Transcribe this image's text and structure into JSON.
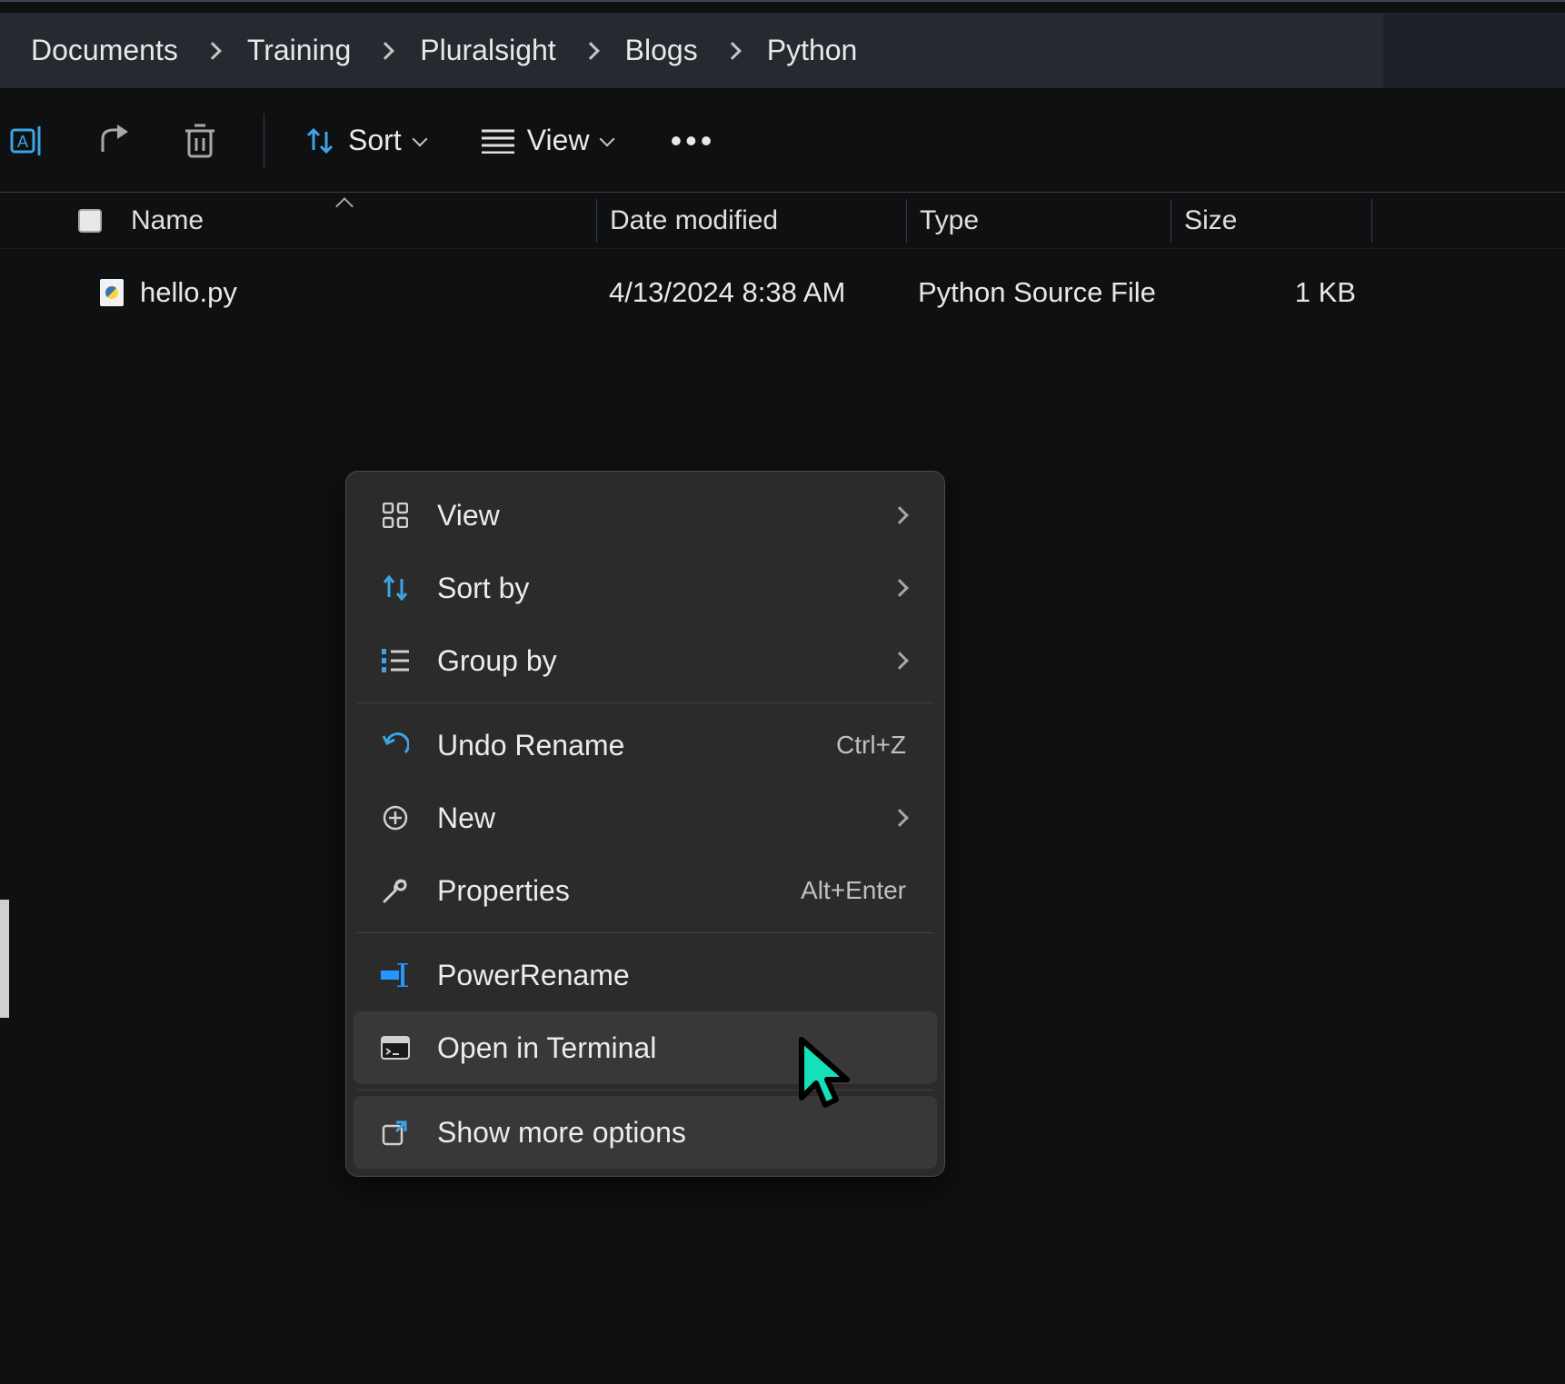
{
  "breadcrumb": [
    "Documents",
    "Training",
    "Pluralsight",
    "Blogs",
    "Python"
  ],
  "toolbar": {
    "sort": "Sort",
    "view": "View"
  },
  "columns": {
    "name": "Name",
    "date": "Date modified",
    "type": "Type",
    "size": "Size"
  },
  "files": [
    {
      "name": "hello.py",
      "date": "4/13/2024 8:38 AM",
      "type": "Python Source File",
      "size": "1 KB"
    }
  ],
  "context_menu": {
    "view": "View",
    "sort_by": "Sort by",
    "group_by": "Group by",
    "undo_rename": "Undo Rename",
    "undo_shortcut": "Ctrl+Z",
    "new": "New",
    "properties": "Properties",
    "properties_shortcut": "Alt+Enter",
    "power_rename": "PowerRename",
    "open_terminal": "Open in Terminal",
    "show_more": "Show more options"
  }
}
